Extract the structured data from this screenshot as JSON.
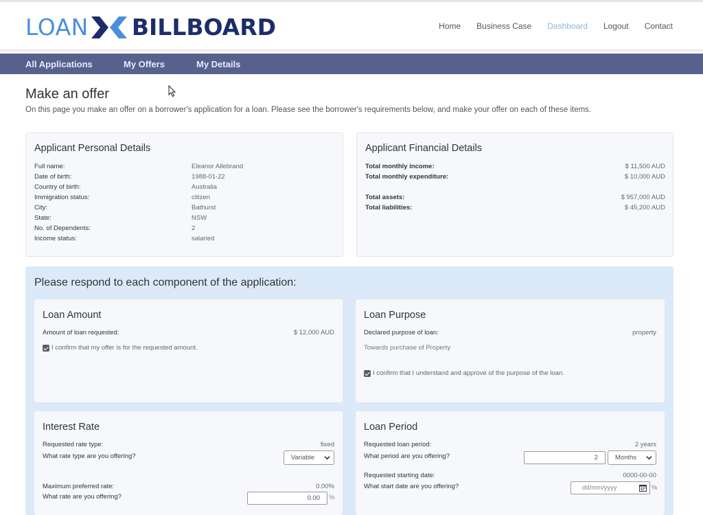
{
  "brand": {
    "part1": "LOAN",
    "part2": "BILLBOARD",
    "colors": {
      "light": "#4a90d9",
      "dark": "#1d2d6b"
    }
  },
  "nav": {
    "items": [
      "Home",
      "Business Case",
      "Dashboard",
      "Logout",
      "Contact"
    ],
    "active": "Dashboard"
  },
  "subnav": {
    "items": [
      "All Applications",
      "My Offers",
      "My Details"
    ]
  },
  "page": {
    "title": "Make an offer",
    "intro": "On this page you make an offer on a borrower's application for a loan. Please see the borrower's requirements below, and make your offer on each of these items."
  },
  "personal": {
    "title": "Applicant Personal Details",
    "rows": [
      {
        "label": "Full name:",
        "value": "Eleanor Allebrand"
      },
      {
        "label": "Date of birth:",
        "value": "1988-01-22"
      },
      {
        "label": "Country of birth:",
        "value": "Australia"
      },
      {
        "label": "Immigration status:",
        "value": "citizen"
      },
      {
        "label": "City:",
        "value": "Bathurst"
      },
      {
        "label": "State:",
        "value": "NSW"
      },
      {
        "label": "No. of Dependents:",
        "value": "2"
      },
      {
        "label": "Income status:",
        "value": "salaried"
      }
    ]
  },
  "financial": {
    "title": "Applicant Financial Details",
    "rows": [
      {
        "label": "Total monthly income:",
        "value": "$ 11,500 AUD"
      },
      {
        "label": "Total monthly expenditure:",
        "value": "$ 10,000 AUD"
      },
      {
        "label": "Total assets:",
        "value": "$ 957,000 AUD"
      },
      {
        "label": "Total liabilities:",
        "value": "$ 45,200 AUD"
      }
    ]
  },
  "respond": {
    "title": "Please respond to each component of the application:"
  },
  "loan_amount": {
    "title": "Loan Amount",
    "label": "Amount of loan requested:",
    "value": "$ 12,000 AUD",
    "confirm": "I confirm that my offer is for the requested amount."
  },
  "loan_purpose": {
    "title": "Loan Purpose",
    "label": "Declared purpose of loan:",
    "value": "property",
    "note": "Towards purchase of Property",
    "confirm": "I confirm that I understand and approve of the purpose of the loan."
  },
  "interest_rate": {
    "title": "Interest Rate",
    "requested_label": "Requested rate type:",
    "requested_value": "fixed",
    "offer_label": "What rate type are you offering?",
    "offer_select": "Variable",
    "max_label": "Maximum preferred rate:",
    "max_value": "0.00%",
    "rate_label": "What rate are you offering?",
    "rate_value": "0.00",
    "rate_suffix": "%"
  },
  "loan_period": {
    "title": "Loan Period",
    "requested_label": "Requested loan period:",
    "requested_value": "2 years",
    "offer_label": "What period are you offering?",
    "period_value": "2",
    "period_unit": "Months",
    "start_label": "Requested starting date:",
    "start_value": "0000-00-00",
    "start_offer_label": "What start date are you offering?",
    "start_placeholder": "dd/mm/yyyy",
    "start_suffix": "%"
  }
}
